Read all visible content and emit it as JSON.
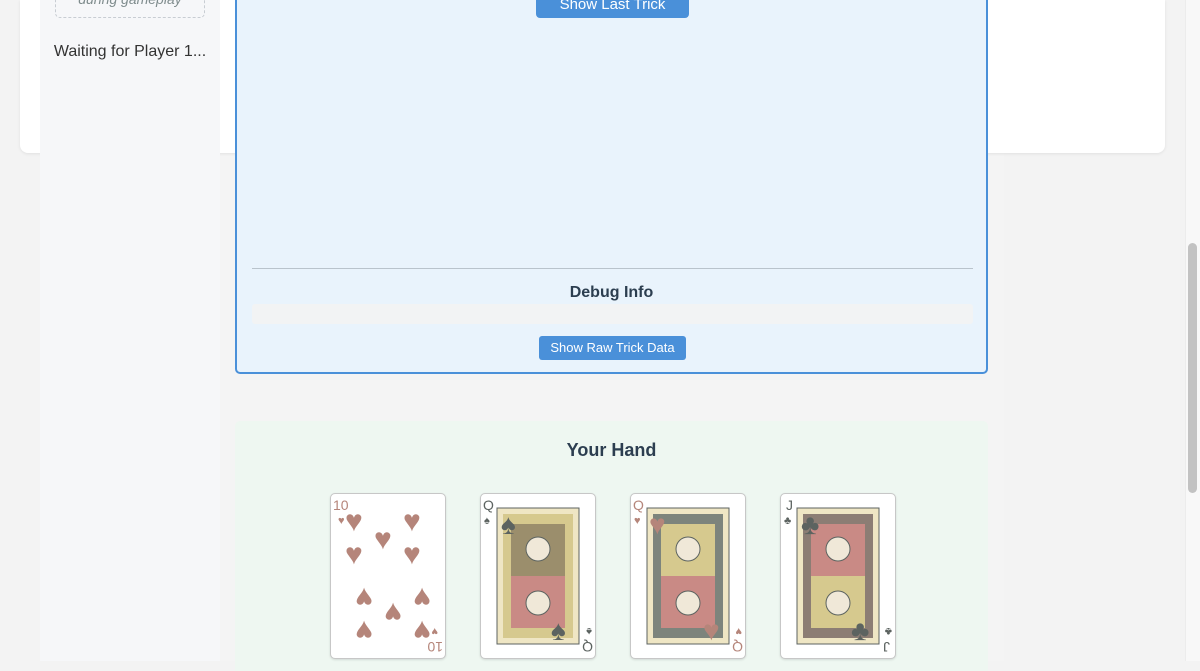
{
  "sidebar": {
    "hint": "during gameplay",
    "status": "Waiting for Player 1..."
  },
  "trick": {
    "show_last_label": "Show Last Trick",
    "debug_title": "Debug Info",
    "raw_button_label": "Show Raw Trick Data"
  },
  "hand": {
    "title": "Your Hand",
    "cards": [
      {
        "rank": "10",
        "suit": "hearts",
        "icon": "hearts-icon"
      },
      {
        "rank": "Q",
        "suit": "spades",
        "icon": "spades-icon"
      },
      {
        "rank": "Q",
        "suit": "hearts",
        "icon": "hearts-icon"
      },
      {
        "rank": "J",
        "suit": "clubs",
        "icon": "clubs-icon"
      }
    ]
  },
  "colors": {
    "accent": "#4a90d9",
    "red_suit": "#b5857a",
    "black_suit": "#5c6360"
  }
}
